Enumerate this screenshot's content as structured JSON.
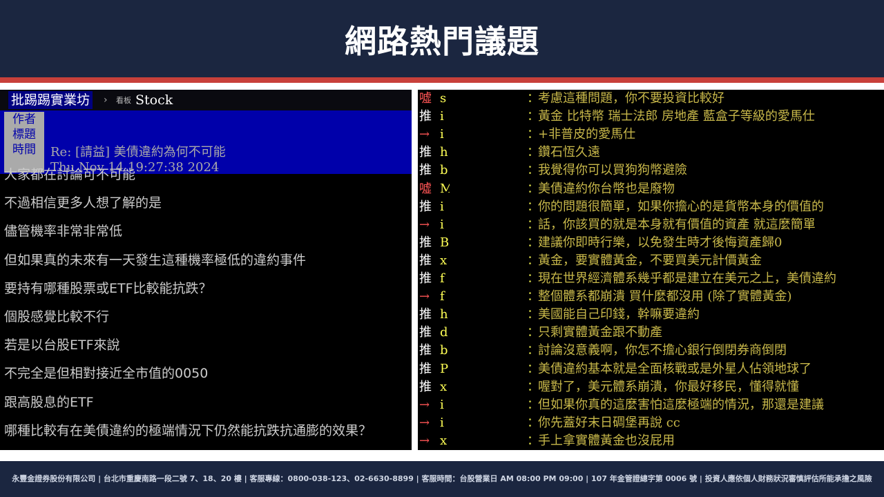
{
  "slide": {
    "title": "網路熱門議題",
    "footer": "永豐金證券股份有限公司 | 台北市重慶南路一段二號 7、18、20 樓 | 客服專線：0800-038-123、02-6630-8899 | 客服時間：台股營業日 AM 08:00 PM 09:00 | 107 年金管證總字第 0006 號 | 投資人應依個人財務狀況審慎評估所能承擔之風險"
  },
  "article": {
    "site_name": "批踢踢實業坊",
    "board_prefix": "看板",
    "board_name": "Stock",
    "labels": {
      "author": "作者",
      "title": "標題",
      "time": "時間"
    },
    "author": "",
    "title": "Re: [請益] 美債違約為何不可能",
    "time": "Thu Nov 14 19:27:38 2024",
    "content": [
      "大家都在討論可不可能",
      "不過相信更多人想了解的是",
      "儘管機率非常非常低",
      "但如果真的未來有一天發生這種機率極低的違約事件",
      "要持有哪種股票或ETF比較能抗跌？",
      "個股感覺比較不行",
      "若是以台股ETF來說",
      "不完全是但相對接近全市值的0050",
      "跟高股息的ETF",
      "哪種比較有在美債違約的極端情況下仍然能抗跌抗通膨的效果？"
    ]
  },
  "comments": [
    {
      "tag": "噓",
      "type": "boo",
      "user": "s",
      "text": "考慮這種問題，你不要投資比較好"
    },
    {
      "tag": "推",
      "type": "push",
      "user": "i",
      "text": "黃金 比特幣 瑞士法郎 房地產 藍盒子等級的愛馬仕"
    },
    {
      "tag": "→",
      "type": "arrow",
      "user": "i",
      "text": "+非普皮的愛馬仕"
    },
    {
      "tag": "推",
      "type": "push",
      "user": "h",
      "text": "鑽石恆久遠"
    },
    {
      "tag": "推",
      "type": "push",
      "user": "b",
      "text": "我覺得你可以買狗狗幣避險"
    },
    {
      "tag": "噓",
      "type": "boo",
      "user": "M",
      "text": "美債違約你台幣也是廢物"
    },
    {
      "tag": "推",
      "type": "push",
      "user": "i",
      "text": "你的問題很簡單，如果你擔心的是貨幣本身的價值的"
    },
    {
      "tag": "→",
      "type": "arrow",
      "user": "i",
      "text": "話，你該買的就是本身就有價值的資產 就這麼簡單"
    },
    {
      "tag": "推",
      "type": "push",
      "user": "B",
      "text": "建議你即時行樂，以免發生時才後悔資產歸0"
    },
    {
      "tag": "推",
      "type": "push",
      "user": "x",
      "text": "黃金，要實體黃金，不要買美元計價黃金"
    },
    {
      "tag": "推",
      "type": "push",
      "user": "f",
      "text": "現在世界經濟體系幾乎都是建立在美元之上，美債違約"
    },
    {
      "tag": "→",
      "type": "arrow",
      "user": "f",
      "text": "整個體系都崩潰 買什麼都沒用 (除了實體黃金)"
    },
    {
      "tag": "推",
      "type": "push",
      "user": "h",
      "text": "美國能自己印錢，幹嘛要違約"
    },
    {
      "tag": "推",
      "type": "push",
      "user": "d",
      "text": "只剩實體黃金跟不動產"
    },
    {
      "tag": "推",
      "type": "push",
      "user": "b",
      "text": "討論沒意義啊，你怎不擔心銀行倒閉券商倒閉"
    },
    {
      "tag": "推",
      "type": "push",
      "user": "P",
      "text": "美債違約基本就是全面核戰或是外星人佔領地球了"
    },
    {
      "tag": "推",
      "type": "push",
      "user": "x",
      "text": "喔對了，美元體系崩潰，你最好移民，懂得就懂"
    },
    {
      "tag": "→",
      "type": "arrow",
      "user": "i",
      "text": "但如果你真的這麼害怕這麼極端的情況，那還是建議"
    },
    {
      "tag": "→",
      "type": "arrow",
      "user": "i",
      "text": "你先蓋好末日碉堡再說 cc"
    },
    {
      "tag": "→",
      "type": "arrow",
      "user": "x",
      "text": "手上拿實體黃金也沒屁用"
    }
  ],
  "colon": "："
}
